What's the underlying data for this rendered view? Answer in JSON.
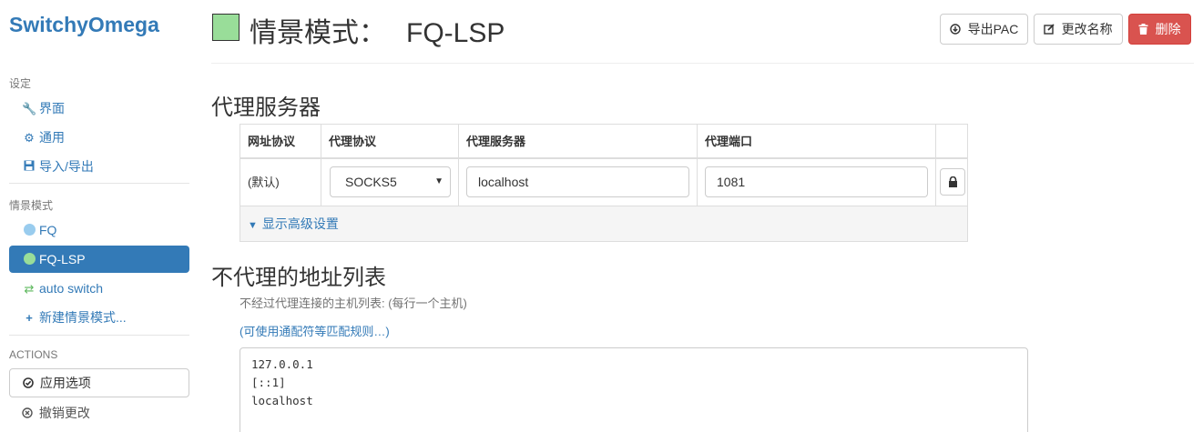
{
  "brand": "SwitchyOmega",
  "sidebar": {
    "settings_header": "设定",
    "settings_items": [
      {
        "label": "界面",
        "icon": "wrench-icon"
      },
      {
        "label": "通用",
        "icon": "gear-icon"
      },
      {
        "label": "导入/导出",
        "icon": "save-icon"
      }
    ],
    "profiles_header": "情景模式",
    "profiles": [
      {
        "label": "FQ",
        "icon": "globe-icon",
        "color": "#99ccee"
      },
      {
        "label": "FQ-LSP",
        "icon": "globe-icon",
        "color": "#99dd99",
        "active": true
      },
      {
        "label": "auto switch",
        "icon": "retweet-icon",
        "color": "#99dd99"
      },
      {
        "label": "新建情景模式...",
        "icon": "plus-icon"
      }
    ],
    "actions_header": "ACTIONS",
    "apply_label": "应用选项",
    "discard_label": "撤销更改"
  },
  "header": {
    "title_prefix": "情景模式：",
    "profile_name": "FQ-LSP",
    "swatch_color": "#99dd99",
    "export_pac_label": "导出PAC",
    "rename_label": "更改名称",
    "delete_label": "删除"
  },
  "proxy": {
    "section_title": "代理服务器",
    "columns": [
      "网址协议",
      "代理协议",
      "代理服务器",
      "代理端口"
    ],
    "row": {
      "scheme": "(默认)",
      "protocol": "SOCKS5",
      "server": "localhost",
      "port": "1081"
    },
    "advanced_label": "显示高级设置"
  },
  "bypass": {
    "section_title": "不代理的地址列表",
    "help_text": "不经过代理连接的主机列表: (每行一个主机)",
    "wildcard_link": "(可使用通配符等匹配规则…)",
    "list_text": "127.0.0.1\n[::1]\nlocalhost"
  },
  "colors": {
    "accent": "#337ab7",
    "danger": "#d9534f",
    "profile_fq": "#99ccee",
    "profile_fq_lsp": "#99dd99"
  }
}
